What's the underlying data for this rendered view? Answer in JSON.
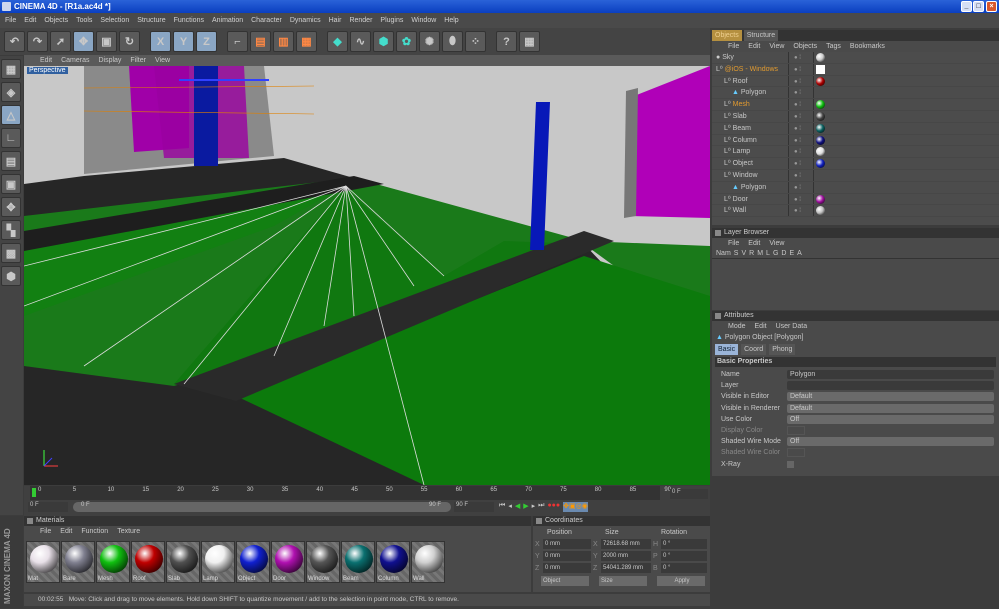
{
  "window": {
    "title": "CINEMA 4D - [R1a.ac4d *]",
    "minimize": "_",
    "maximize": "□",
    "close": "×"
  },
  "menu": [
    "File",
    "Edit",
    "Objects",
    "Tools",
    "Selection",
    "Structure",
    "Functions",
    "Animation",
    "Character",
    "Dynamics",
    "Hair",
    "Render",
    "Plugins",
    "Window",
    "Help"
  ],
  "toolbar": [
    "undo",
    "redo",
    "live-selection",
    "move",
    "scale",
    "rotate",
    "x-axis",
    "y-axis",
    "z-axis",
    "coordinate-system",
    "render-view",
    "render-picture-viewer",
    "render-settings",
    "cube",
    "spline",
    "nurbs",
    "array",
    "deformer",
    "scene",
    "particles",
    "help",
    "layout"
  ],
  "toolbar_labels": {
    "x": "X",
    "y": "Y",
    "z": "Z"
  },
  "viewport": {
    "menu": [
      "Edit",
      "Cameras",
      "Display",
      "Filter",
      "View"
    ],
    "label": "Perspective"
  },
  "object_manager": {
    "tabs": [
      "Objects",
      "Structure"
    ],
    "menu": [
      "File",
      "Edit",
      "View",
      "Objects",
      "Tags",
      "Bookmarks"
    ],
    "objects": [
      {
        "name": "Sky",
        "indent": 0,
        "color": "#cccccc",
        "highlight": false,
        "tag": "sky"
      },
      {
        "name": "@iOS - Windows",
        "indent": 0,
        "color": "",
        "highlight": true,
        "tag": "texture"
      },
      {
        "name": "Roof",
        "indent": 1,
        "color": "#b00000",
        "highlight": false
      },
      {
        "name": "Polygon",
        "indent": 2,
        "color": "",
        "highlight": false,
        "poly": true
      },
      {
        "name": "Mesh",
        "indent": 1,
        "color": "#10c010",
        "highlight": true
      },
      {
        "name": "Slab",
        "indent": 1,
        "color": "#444444",
        "highlight": false
      },
      {
        "name": "Beam",
        "indent": 1,
        "color": "#0a6060",
        "highlight": false
      },
      {
        "name": "Column",
        "indent": 1,
        "color": "#101080",
        "highlight": false
      },
      {
        "name": "Lamp",
        "indent": 1,
        "color": "#e0e0e0",
        "highlight": false
      },
      {
        "name": "Object",
        "indent": 1,
        "color": "#1020c0",
        "highlight": false
      },
      {
        "name": "Window",
        "indent": 1,
        "color": "",
        "highlight": false
      },
      {
        "name": "Polygon",
        "indent": 2,
        "color": "",
        "highlight": false,
        "poly": true
      },
      {
        "name": "Door",
        "indent": 1,
        "color": "#a010a0",
        "highlight": false
      },
      {
        "name": "Wall",
        "indent": 1,
        "color": "#c0c0c0",
        "highlight": false
      }
    ]
  },
  "layer_browser": {
    "title": "Layer Browser",
    "menu": [
      "File",
      "Edit",
      "View"
    ],
    "columns": [
      "Nam",
      "S",
      "V",
      "R",
      "M",
      "L",
      "G",
      "D",
      "E",
      "A"
    ]
  },
  "attributes": {
    "title": "Attributes",
    "menu": [
      "Mode",
      "Edit",
      "User Data"
    ],
    "object": "Polygon Object [Polygon]",
    "tabs": [
      "Basic",
      "Coord",
      "Phong"
    ],
    "section": "Basic Properties",
    "fields": [
      {
        "label": "Name",
        "value": "Polygon",
        "dim": false,
        "type": "text"
      },
      {
        "label": "Layer",
        "value": "",
        "dim": false,
        "type": "text"
      },
      {
        "label": "Visible in Editor",
        "value": "Default",
        "dim": false,
        "type": "dd"
      },
      {
        "label": "Visible in Renderer",
        "value": "Default",
        "dim": false,
        "type": "dd"
      },
      {
        "label": "Use Color",
        "value": "Off",
        "dim": false,
        "type": "dd"
      },
      {
        "label": "Display Color",
        "value": "",
        "dim": true,
        "type": "color"
      },
      {
        "label": "Shaded Wire Mode",
        "value": "Off",
        "dim": false,
        "type": "dd"
      },
      {
        "label": "Shaded Wire Color",
        "value": "",
        "dim": true,
        "type": "color"
      },
      {
        "label": "X-Ray",
        "value": "",
        "dim": false,
        "type": "check"
      }
    ]
  },
  "timeline": {
    "ticks": [
      "0",
      "5",
      "10",
      "15",
      "20",
      "25",
      "30",
      "35",
      "40",
      "45",
      "50",
      "55",
      "60",
      "65",
      "70",
      "75",
      "80",
      "85",
      "90"
    ],
    "current": "0 F",
    "start": "0 F",
    "range_start": "0 F",
    "range_end": "90 F",
    "end": "90 F",
    "progress": 0
  },
  "materials": {
    "title": "Materials",
    "menu": [
      "File",
      "Edit",
      "Function",
      "Texture"
    ],
    "items": [
      {
        "name": "Mat",
        "color": "#e8e0e8"
      },
      {
        "name": "Bare",
        "color": "#808090"
      },
      {
        "name": "Mesh",
        "color": "#10c010"
      },
      {
        "name": "Roof",
        "color": "#c00000"
      },
      {
        "name": "Slab",
        "color": "#505050"
      },
      {
        "name": "Lamp",
        "color": "#f0f0f0"
      },
      {
        "name": "Object",
        "color": "#1020d0"
      },
      {
        "name": "Door",
        "color": "#b010b0"
      },
      {
        "name": "Window",
        "color": "#555555"
      },
      {
        "name": "Beam",
        "color": "#0a7070"
      },
      {
        "name": "Column",
        "color": "#101090"
      },
      {
        "name": "Wall",
        "color": "#d0d0d0"
      }
    ]
  },
  "coordinates": {
    "title": "Coordinates",
    "headers": [
      "Position",
      "Size",
      "Rotation"
    ],
    "rows": [
      {
        "axis": "X",
        "pos": "0 mm",
        "saxis": "X",
        "size": "72618.68 mm",
        "raxis": "H",
        "rot": "0 °"
      },
      {
        "axis": "Y",
        "pos": "0 mm",
        "saxis": "Y",
        "size": "2000 mm",
        "raxis": "P",
        "rot": "0 °"
      },
      {
        "axis": "Z",
        "pos": "0 mm",
        "saxis": "Z",
        "size": "54041.289 mm",
        "raxis": "B",
        "rot": "0 °"
      }
    ],
    "mode": "Object",
    "size_mode": "Size",
    "apply": "Apply"
  },
  "status": {
    "time": "00:02:55",
    "message": "Move: Click and drag to move elements. Hold down SHIFT to quantize movement / add to the selection in point mode, CTRL to remove."
  },
  "logo": "MAXON CINEMA 4D"
}
